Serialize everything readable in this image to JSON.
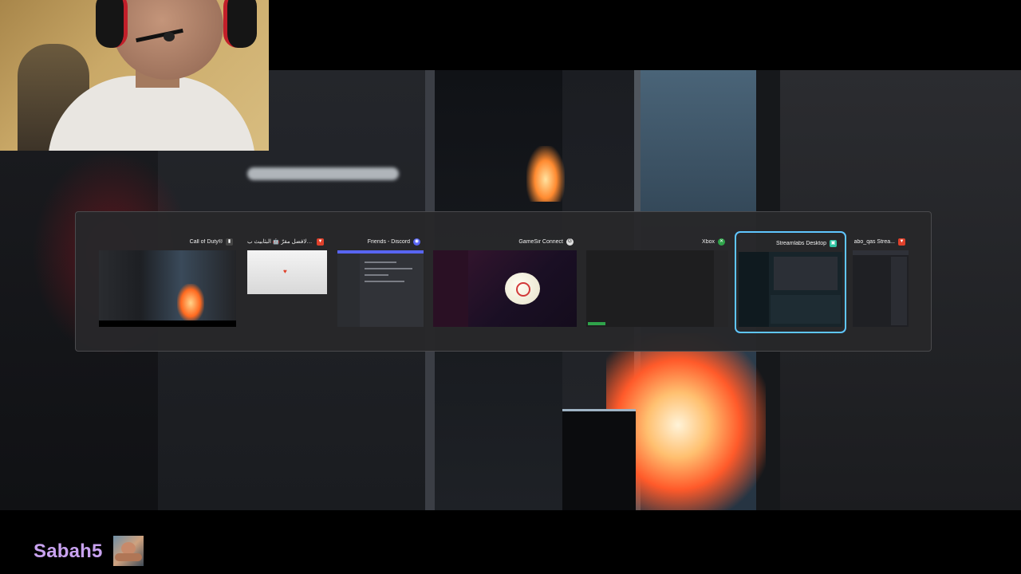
{
  "overlay": {
    "channel_name": "Sabah5"
  },
  "task_switcher": {
    "windows": [
      {
        "title": "Call of Duty®",
        "icon": "call-of-duty-icon"
      },
      {
        "title": "من الافضل مقرّ 🤖 البثابيث ب...",
        "icon": "brave-icon"
      },
      {
        "title": "Friends - Discord",
        "icon": "discord-icon"
      },
      {
        "title": "GameSir Connect",
        "icon": "gamesir-icon"
      },
      {
        "title": "Xbox",
        "icon": "xbox-icon"
      },
      {
        "title": "Streamlabs Desktop",
        "icon": "streamlabs-icon",
        "selected": true
      },
      {
        "title": "abo_qas Strea...",
        "icon": "brave-icon"
      }
    ]
  },
  "colors": {
    "channel_name": "#c8a2ef",
    "selection": "#5fc6ff",
    "switcher_bg": "#28282a"
  }
}
